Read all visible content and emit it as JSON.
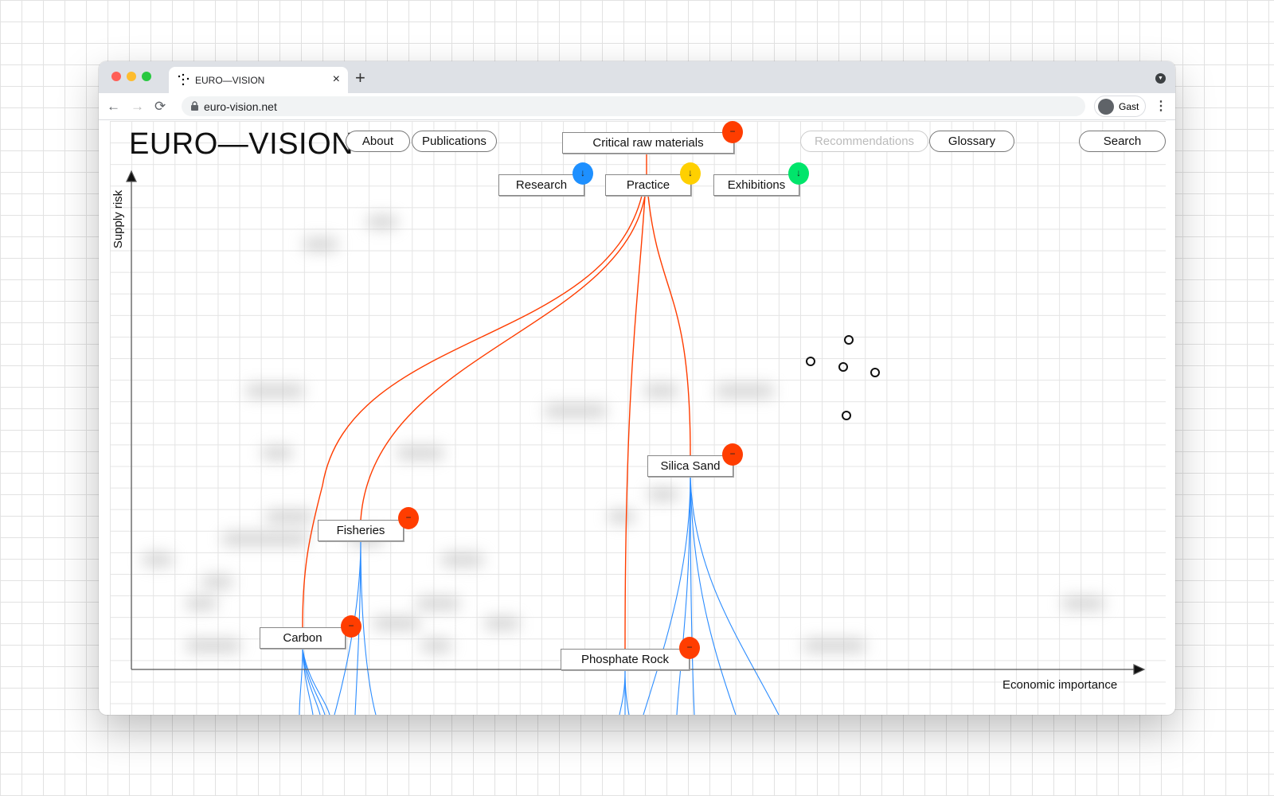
{
  "browser": {
    "tab_title": "EURO—VISION",
    "tab_close": "×",
    "new_tab": "+",
    "url": "euro-vision.net",
    "profile_name": "Gast",
    "nav": {
      "back": "←",
      "forward": "→",
      "reload": "⟳"
    },
    "menu": "⋮",
    "traffic_colors": [
      "#ff5f57",
      "#febc2e",
      "#28c840"
    ]
  },
  "site": {
    "logo": "EURO—VISION",
    "nav": [
      {
        "label": "About",
        "enabled": true
      },
      {
        "label": "Publications",
        "enabled": true
      },
      {
        "label": "Recommendations",
        "enabled": false
      },
      {
        "label": "Glossary",
        "enabled": true
      },
      {
        "label": "Search",
        "enabled": true
      }
    ]
  },
  "graph": {
    "root": {
      "label": "Critical raw materials",
      "badge": "−",
      "badge_color": "#ff3d00"
    },
    "categories": [
      {
        "label": "Research",
        "badge": "↓",
        "badge_color": "#1e90ff"
      },
      {
        "label": "Practice",
        "badge": "↓",
        "badge_color": "#ffd000"
      },
      {
        "label": "Exhibitions",
        "badge": "↓",
        "badge_color": "#00e56b"
      }
    ],
    "materials": [
      {
        "label": "Silica Sand",
        "badge": "−"
      },
      {
        "label": "Fisheries",
        "badge": "−"
      },
      {
        "label": "Carbon",
        "badge": "−"
      },
      {
        "label": "Phosphate Rock",
        "badge": "−"
      }
    ],
    "material_badge_color": "#ff3d00",
    "link_color_parent": "#ff3d00",
    "link_color_child": "#2b8cff",
    "y_axis_label": "Supply risk",
    "x_axis_label": "Economic importance"
  }
}
